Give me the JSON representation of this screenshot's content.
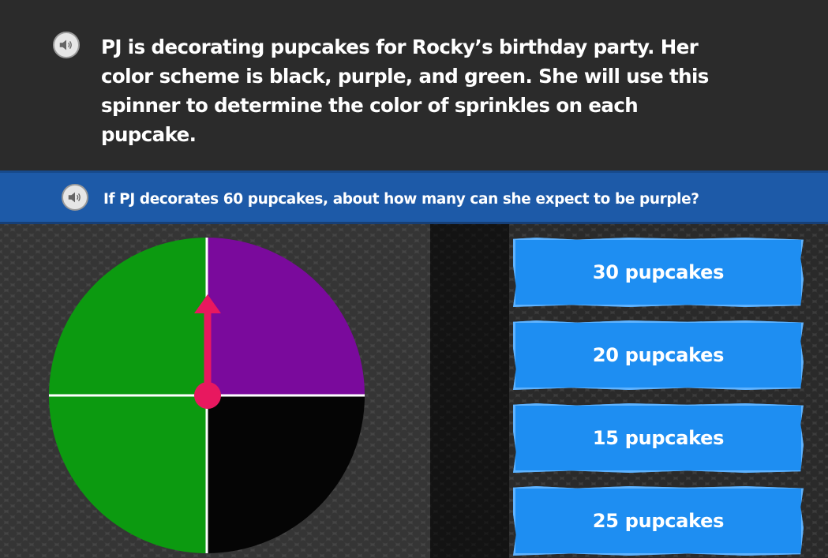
{
  "story": {
    "text": "PJ is decorating pupcakes for Rocky’s birthday party. Her color scheme is black, purple, and green. She will use this spinner to determine the color of sprinkles on each pupcake."
  },
  "question": {
    "text": "If PJ decorates 60 pupcakes, about how many can she expect to be purple?"
  },
  "answers": [
    {
      "label": "30 pupcakes"
    },
    {
      "label": "20 pupcakes"
    },
    {
      "label": "15 pupcakes"
    },
    {
      "label": "25 pupcakes"
    }
  ],
  "spinner": {
    "sections": [
      {
        "color_name": "purple",
        "color": "#7a0a9c"
      },
      {
        "color_name": "black",
        "color": "#050505"
      },
      {
        "color_name": "green",
        "color": "#0c9a10"
      },
      {
        "color_name": "green",
        "color": "#0c9a10"
      }
    ],
    "arrow_color": "#e8185f"
  },
  "icons": {
    "audio": "speaker-icon"
  }
}
